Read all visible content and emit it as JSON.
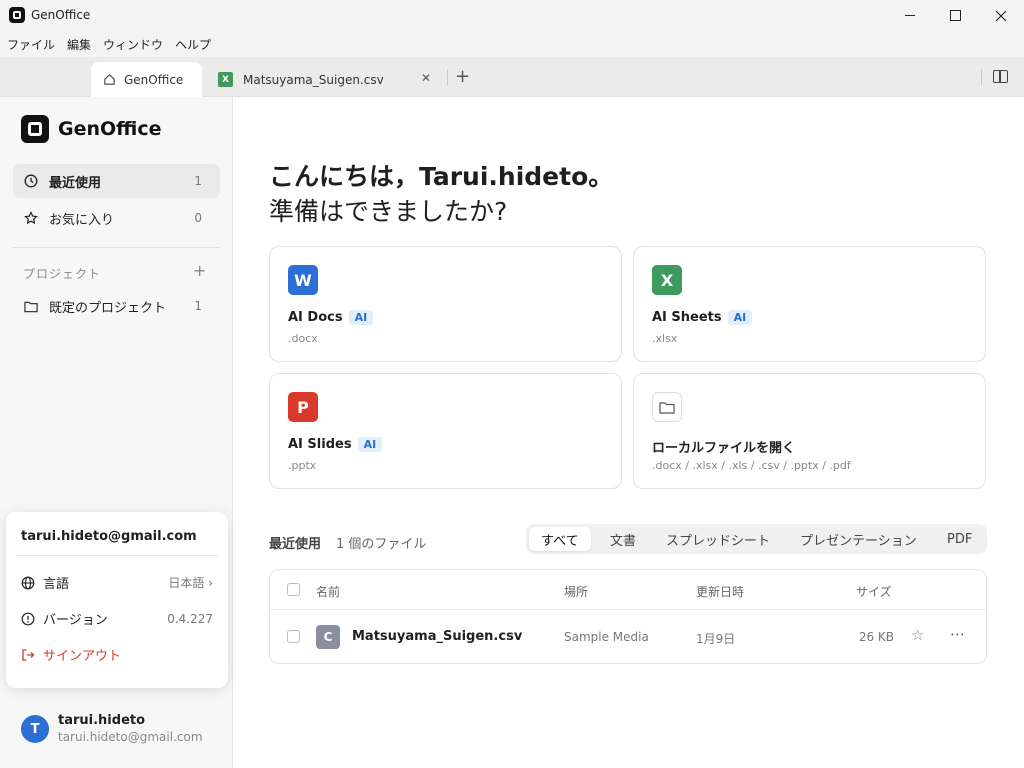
{
  "window": {
    "title": "GenOffice"
  },
  "menu": [
    "ファイル",
    "編集",
    "ウィンドウ",
    "ヘルプ"
  ],
  "tabs": {
    "home": "GenOffice",
    "csv": "Matsuyama_Suigen.csv",
    "csv_badge": "X"
  },
  "sidebar": {
    "logo": "GenOffice",
    "nav": [
      {
        "label": "最近使用",
        "count": "1"
      },
      {
        "label": "お気に入り",
        "count": "0"
      }
    ],
    "projects_label": "プロジェクト",
    "project": {
      "label": "既定のプロジェクト",
      "count": "1"
    }
  },
  "account": {
    "email": "tarui.hideto@gmail.com",
    "language_label": "言語",
    "language_value": "日本語",
    "version_label": "バージョン",
    "version_value": "0.4.227",
    "signout_label": "サインアウト"
  },
  "user": {
    "initial": "T",
    "name": "tarui.hideto",
    "email": "tarui.hideto@gmail.com"
  },
  "greeting": {
    "line1": "こんにちは，Tarui.hideto。",
    "line2": "準備はできましたか?"
  },
  "cards": {
    "docs": {
      "icon": "W",
      "title": "AI Docs",
      "badge": "AI",
      "sub": ".docx"
    },
    "sheets": {
      "icon": "X",
      "title": "AI Sheets",
      "badge": "AI",
      "sub": ".xlsx"
    },
    "slides": {
      "icon": "P",
      "title": "AI Slides",
      "badge": "AI",
      "sub": ".pptx"
    },
    "open": {
      "title": "ローカルファイルを開く",
      "sub": ".docx / .xlsx / .xls / .csv / .pptx / .pdf"
    }
  },
  "recent": {
    "title": "最近使用",
    "count_text": "1 個のファイル",
    "filters": [
      "すべて",
      "文書",
      "スプレッドシート",
      "プレゼンテーション",
      "PDF"
    ],
    "columns": {
      "name": "名前",
      "location": "場所",
      "modified": "更新日時",
      "size": "サイズ"
    },
    "files": [
      {
        "icon": "C",
        "name": "Matsuyama_Suigen.csv",
        "location": "Sample Media",
        "modified": "1月9日",
        "size": "26 KB"
      }
    ]
  },
  "colors": {
    "word": "#2b6fd6",
    "excel": "#3e9b5d",
    "powerpoint": "#d9392b",
    "signout": "#d33b2d",
    "accent": "#2b6fd6"
  }
}
